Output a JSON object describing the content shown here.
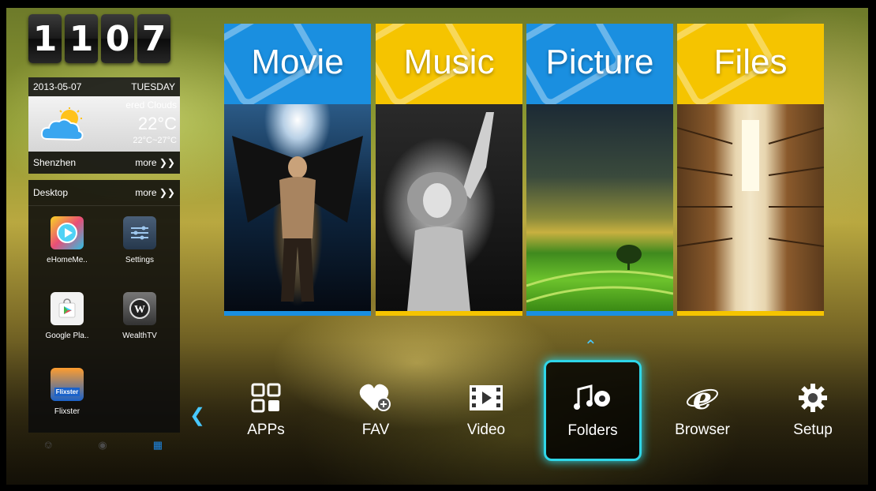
{
  "clock": {
    "digits": [
      "1",
      "1",
      "0",
      "7"
    ]
  },
  "weather": {
    "date": "2013-05-07",
    "weekday": "TUESDAY",
    "condition": "ered Clouds",
    "temperature": "22°C",
    "range": "22°C~27°C",
    "city": "Shenzhen",
    "more_label": "more ❯❯"
  },
  "desktop": {
    "title": "Desktop",
    "more_label": "more ❯❯",
    "apps": [
      {
        "label": "eHomeMe..",
        "icon": "ehome-media-icon"
      },
      {
        "label": "Settings",
        "icon": "settings-icon"
      },
      {
        "label": "Google Pla..",
        "icon": "google-play-icon"
      },
      {
        "label": "WealthTV",
        "icon": "wealthtv-icon"
      },
      {
        "label": "Flixster",
        "icon": "flixster-icon"
      }
    ],
    "flixster_badge": "Flixster"
  },
  "status_icons": [
    "usb-icon",
    "wifi-icon",
    "ethernet-icon"
  ],
  "tiles": [
    {
      "label": "Movie",
      "color": "#1a8fe0"
    },
    {
      "label": "Music",
      "color": "#f5c400"
    },
    {
      "label": "Picture",
      "color": "#1a8fe0"
    },
    {
      "label": "Files",
      "color": "#f5c400"
    }
  ],
  "nav": {
    "items": [
      {
        "label": "APPs",
        "icon": "apps-grid-icon"
      },
      {
        "label": "FAV",
        "icon": "heart-plus-icon"
      },
      {
        "label": "Video",
        "icon": "film-play-icon"
      },
      {
        "label": "Folders",
        "icon": "music-folder-icon"
      },
      {
        "label": "Browser",
        "icon": "browser-e-icon"
      },
      {
        "label": "Setup",
        "icon": "gear-icon"
      }
    ],
    "selected": "Folders"
  },
  "colors": {
    "accent": "#2fd6e8",
    "blue": "#1a8fe0",
    "yellow": "#f5c400"
  }
}
